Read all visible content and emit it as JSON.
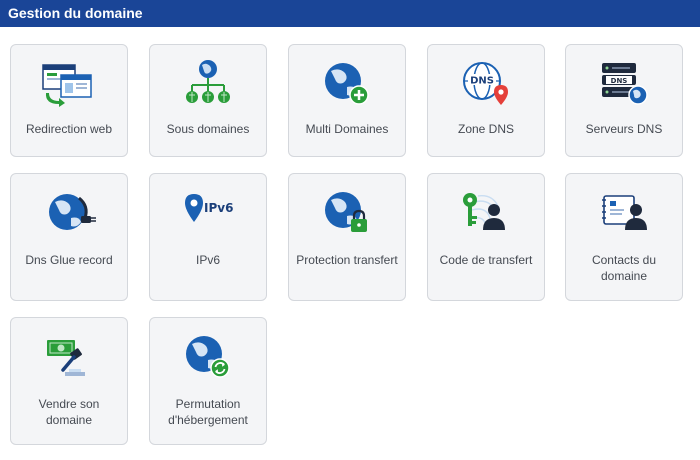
{
  "header": {
    "title": "Gestion du domaine"
  },
  "colors": {
    "header_bg": "#1a4597",
    "tile_bg": "#f4f5f7",
    "tile_border": "#d4d7dc",
    "label": "#454a52",
    "accent_blue": "#1b61b3",
    "accent_green": "#2a9d3a",
    "accent_red": "#e5403a"
  },
  "tiles": [
    {
      "label": "Redirection web",
      "icon": "web-redirect-icon"
    },
    {
      "label": "Sous domaines",
      "icon": "subdomains-icon"
    },
    {
      "label": "Multi Domaines",
      "icon": "globe-plus-icon"
    },
    {
      "label": "Zone DNS",
      "icon": "dns-zone-icon"
    },
    {
      "label": "Serveurs DNS",
      "icon": "dns-servers-icon"
    },
    {
      "label": "Dns Glue record",
      "icon": "glue-record-icon"
    },
    {
      "label": "IPv6",
      "icon": "ipv6-icon",
      "icon_text": "IPv6"
    },
    {
      "label": "Protection transfert",
      "icon": "globe-lock-icon"
    },
    {
      "label": "Code de transfert",
      "icon": "transfer-code-icon"
    },
    {
      "label": "Contacts du domaine",
      "icon": "domain-contacts-icon"
    },
    {
      "label": "Vendre son domaine",
      "icon": "sell-domain-icon"
    },
    {
      "label": "Permutation d'hébergement",
      "icon": "hosting-swap-icon"
    }
  ]
}
